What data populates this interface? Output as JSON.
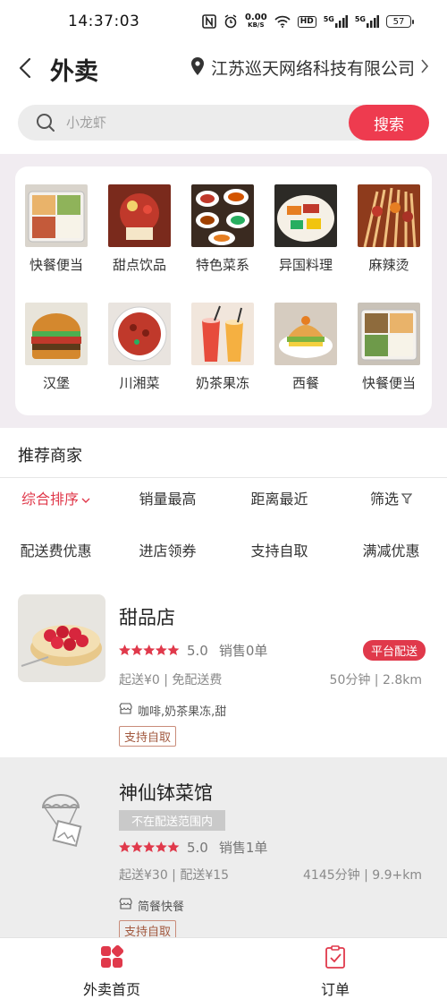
{
  "status_bar": {
    "time": "14:37:03",
    "speed_value": "0.00",
    "speed_unit": "KB/S",
    "hd_label": "HD",
    "signal1_label": "5G",
    "signal2_label": "5G",
    "battery": "57"
  },
  "header": {
    "title": "外卖",
    "location": "江苏巡天网络科技有限公司"
  },
  "search": {
    "placeholder": "小龙虾",
    "button_label": "搜索"
  },
  "categories": [
    {
      "label": "快餐便当",
      "icon": "bento-photo"
    },
    {
      "label": "甜点饮品",
      "icon": "dessert-photo"
    },
    {
      "label": "特色菜系",
      "icon": "specialty-dishes-photo"
    },
    {
      "label": "异国料理",
      "icon": "foreign-cuisine-photo"
    },
    {
      "label": "麻辣烫",
      "icon": "malatang-photo"
    },
    {
      "label": "汉堡",
      "icon": "burger-photo"
    },
    {
      "label": "川湘菜",
      "icon": "sichuan-dish-photo"
    },
    {
      "label": "奶茶果冻",
      "icon": "milk-tea-photo"
    },
    {
      "label": "西餐",
      "icon": "western-food-photo"
    },
    {
      "label": "快餐便当",
      "icon": "bento-photo"
    }
  ],
  "recommend": {
    "title": "推荐商家",
    "sort_filters": [
      "综合排序",
      "销量最高",
      "距离最近",
      "筛选"
    ],
    "promo_filters": [
      "配送费优惠",
      "进店领券",
      "支持自取",
      "满减优惠"
    ]
  },
  "stores": [
    {
      "name": "甜品店",
      "rating": "5.0",
      "sales": "销售0单",
      "delivery_info": "起送¥0 | 免配送费",
      "time_distance": "50分钟 | 2.8km",
      "tags": "咖啡,奶茶果冻,甜",
      "pickup": "支持自取",
      "platform_badge": "平台配送"
    },
    {
      "name": "神仙钵菜馆",
      "status": "不在配送范围内",
      "rating": "5.0",
      "sales": "销售1单",
      "delivery_info": "起送¥30 | 配送¥15",
      "time_distance": "4145分钟 | 9.9+km",
      "tags": "简餐快餐",
      "pickup": "支持自取"
    }
  ],
  "bottom_nav": [
    {
      "label": "外卖首页",
      "icon": "home-grid-icon"
    },
    {
      "label": "订单",
      "icon": "order-clipboard-icon"
    }
  ],
  "colors": {
    "accent": "#e0394b",
    "search_button": "#ee3b4f",
    "category_bg": "#f1ecf1",
    "disabled_store_bg": "#ededed"
  }
}
